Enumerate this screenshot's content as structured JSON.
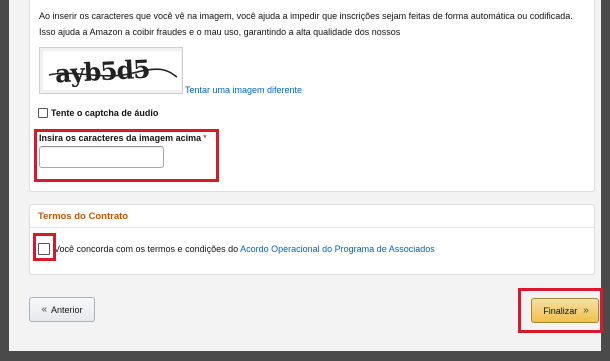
{
  "captcha": {
    "intro_text": "Ao inserir os caracteres que você vê na imagem, você ajuda a impedir que inscrições sejam feitas de forma automática ou codificada. Isso ajuda a Amazon a coibir fraudes e o mau uso, garantindo a alta qualidade dos nossos",
    "image_text": "ayb5d5",
    "alt_image_link": "Tentar uma imagem diferente",
    "audio_label": "Tente o captcha de áudio",
    "input_label": "Insira os caracteres da imagem acima",
    "required_mark": "*",
    "input_value": ""
  },
  "terms": {
    "title": "Termos do Contrato",
    "agree_prefix": "Você concorda com os termos e condições do ",
    "agreement_link": "Acordo Operacional do Programa de Associados",
    "checked": false
  },
  "nav": {
    "prev_label": "Anterior",
    "prev_icon": "double-chevron-left-icon",
    "next_label": "Finalizar",
    "next_icon": "double-chevron-right-icon"
  },
  "colors": {
    "highlight": "#d7192a",
    "link": "#0066c0",
    "section_title": "#c45500",
    "primary_button": "#f0c14b"
  }
}
